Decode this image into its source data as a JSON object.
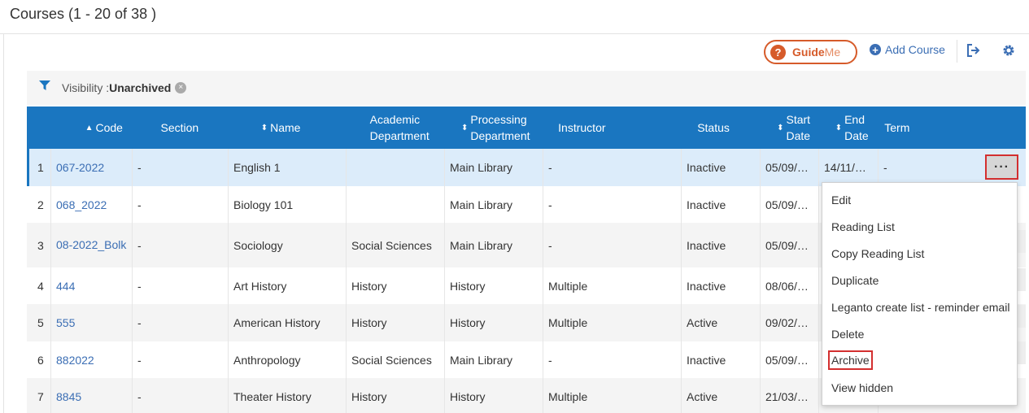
{
  "page": {
    "title": "Courses (1 - 20 of 38 )"
  },
  "toolbar": {
    "guideme_q": "?",
    "guideme_guide": "Guide",
    "guideme_me": "Me",
    "add_course_label": "Add Course",
    "add_icon_glyph": "+",
    "icons": [
      "export-icon",
      "gear-icon"
    ]
  },
  "filter": {
    "label": "Visibility : ",
    "value": "Unarchived",
    "clear_glyph": "×"
  },
  "table": {
    "headers": {
      "code": "Code",
      "section": "Section",
      "name": "Name",
      "academic_department": "Academic Department",
      "processing_department": "Processing Department",
      "instructor": "Instructor",
      "status": "Status",
      "start_date": "Start Date",
      "end_date": "End Date",
      "term": "Term"
    },
    "rows": [
      {
        "num": "1",
        "code": "067-2022",
        "section": "-",
        "name": "English 1",
        "academic": "",
        "processing": "Main Library",
        "instructor": "-",
        "status": "Inactive",
        "start": "05/09/…",
        "end": "14/11/…",
        "term": "-"
      },
      {
        "num": "2",
        "code": "068_2022",
        "section": "-",
        "name": "Biology 101",
        "academic": "",
        "processing": "Main Library",
        "instructor": "-",
        "status": "Inactive",
        "start": "05/09/…",
        "end": "",
        "term": ""
      },
      {
        "num": "3",
        "code": "08-2022_Bolk",
        "section": "-",
        "name": "Sociology",
        "academic": "Social Sciences",
        "processing": "Main Library",
        "instructor": "-",
        "status": "Inactive",
        "start": "05/09/…",
        "end": "",
        "term": ""
      },
      {
        "num": "4",
        "code": "444",
        "section": "-",
        "name": "Art History",
        "academic": "History",
        "processing": "History",
        "instructor": "Multiple",
        "status": "Inactive",
        "start": "08/06/…",
        "end": "",
        "term": ""
      },
      {
        "num": "5",
        "code": "555",
        "section": "-",
        "name": "American History",
        "academic": "History",
        "processing": "History",
        "instructor": "Multiple",
        "status": "Active",
        "start": "09/02/…",
        "end": "",
        "term": ""
      },
      {
        "num": "6",
        "code": "882022",
        "section": "-",
        "name": "Anthropology",
        "academic": "Social Sciences",
        "processing": "Main Library",
        "instructor": "-",
        "status": "Inactive",
        "start": "05/09/…",
        "end": "",
        "term": ""
      },
      {
        "num": "7",
        "code": "8845",
        "section": "-",
        "name": "Theater History",
        "academic": "History",
        "processing": "History",
        "instructor": "Multiple",
        "status": "Active",
        "start": "21/03/…",
        "end": "",
        "term": ""
      }
    ],
    "row_menu_glyph": "···"
  },
  "row_menu": {
    "items": [
      "Edit",
      "Reading List",
      "Copy Reading List",
      "Duplicate",
      "Leganto create list - reminder email",
      "Delete",
      "Archive",
      "View hidden"
    ]
  },
  "colors": {
    "header_bg": "#1a76c0",
    "link": "#3b6eb4",
    "guideme": "#d65b2a",
    "highlight_box": "#d32f2f",
    "selected_row": "#dcecfa"
  }
}
